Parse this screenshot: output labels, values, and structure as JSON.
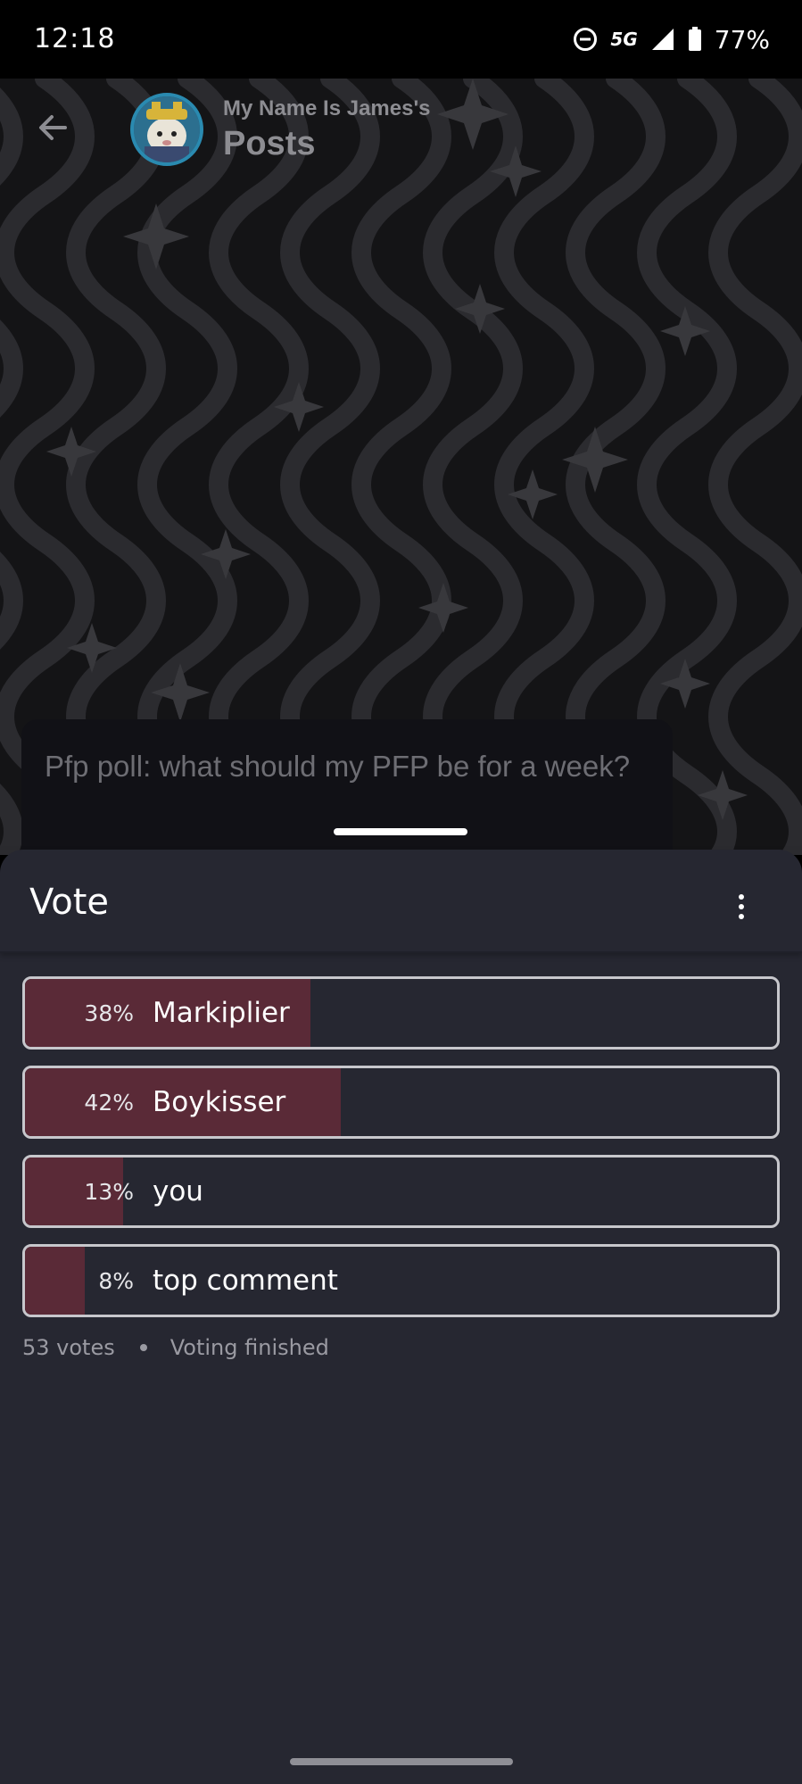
{
  "status_bar": {
    "time": "12:18",
    "network": "5G",
    "battery": "77%",
    "icons": [
      "do-not-disturb-icon",
      "5g-icon",
      "signal-icon",
      "battery-icon"
    ]
  },
  "header": {
    "subtitle": "My Name Is James's",
    "title": "Posts"
  },
  "post": {
    "text": "Pfp poll: what should my PFP be for a week?"
  },
  "sheet": {
    "title": "Vote",
    "options": [
      {
        "pct": "38%",
        "label": "Markiplier",
        "value": 0.38
      },
      {
        "pct": "42%",
        "label": "Boykisser",
        "value": 0.42
      },
      {
        "pct": "13%",
        "label": "you",
        "value": 0.13
      },
      {
        "pct": "8%",
        "label": "top comment",
        "value": 0.08
      }
    ],
    "votes": "53 votes",
    "status": "Voting finished"
  },
  "colors": {
    "sheet_bg": "#262731",
    "vote_fill": "#5a2a37",
    "option_border": "#c7c7cc",
    "page_bg": "#141416"
  }
}
